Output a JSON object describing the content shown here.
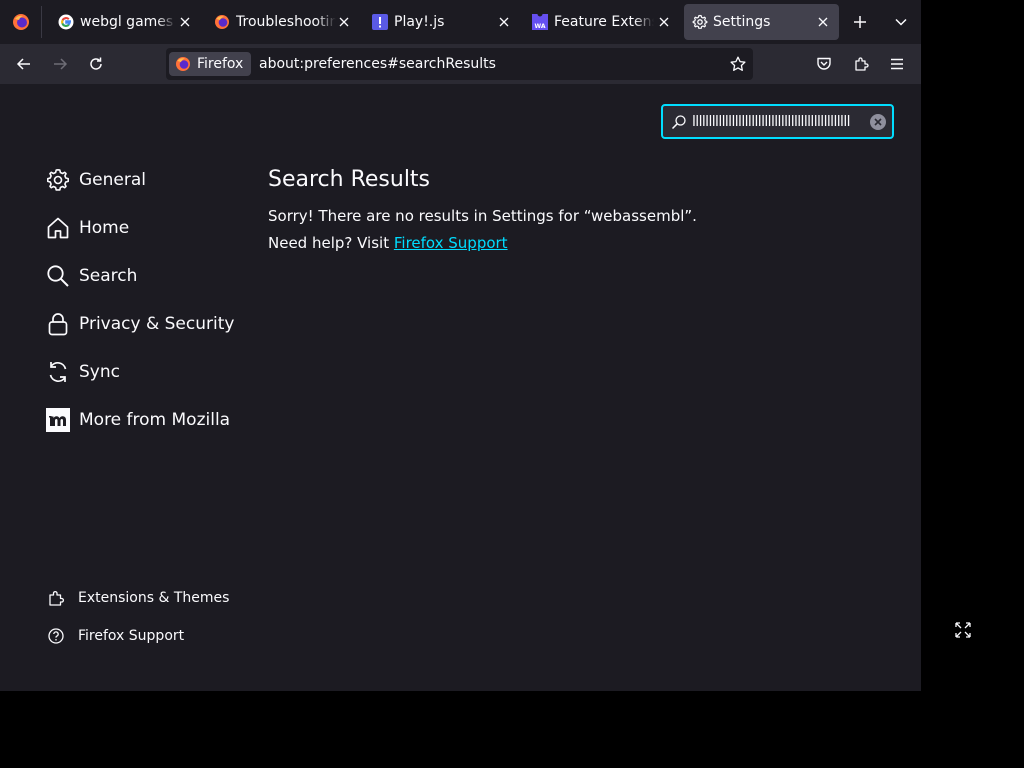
{
  "tabs": [
    {
      "title": "webgl games -",
      "favicon": "google-icon",
      "active": false
    },
    {
      "title": "Troubleshooting",
      "favicon": "firefox-icon",
      "active": false
    },
    {
      "title": "Play!.js",
      "favicon": "playjs-icon",
      "active": false
    },
    {
      "title": "Feature Extensions",
      "favicon": "webassembly-icon",
      "active": false
    },
    {
      "title": "Settings",
      "favicon": "gear-icon",
      "active": true
    }
  ],
  "toolbar": {
    "identity_label": "Firefox",
    "url": "about:preferences#searchResults"
  },
  "search": {
    "value": "llllllllllllllllllllllllllllllllllllllllllllllll"
  },
  "sidebar": {
    "items": [
      {
        "label": "General",
        "icon": "gear-icon"
      },
      {
        "label": "Home",
        "icon": "home-icon"
      },
      {
        "label": "Search",
        "icon": "search-icon"
      },
      {
        "label": "Privacy & Security",
        "icon": "lock-icon"
      },
      {
        "label": "Sync",
        "icon": "sync-icon"
      },
      {
        "label": "More from Mozilla",
        "icon": "mozilla-icon"
      }
    ],
    "footer": [
      {
        "label": "Extensions & Themes",
        "icon": "puzzle-icon"
      },
      {
        "label": "Firefox Support",
        "icon": "help-icon"
      }
    ]
  },
  "results": {
    "title": "Search Results",
    "message": "Sorry! There are no results in Settings for “webassembl”.",
    "help_prefix": "Need help? Visit ",
    "help_link": "Firefox Support"
  },
  "colors": {
    "accent": "#00ddff",
    "background": "#1c1b22",
    "toolbar": "#2b2a33",
    "active_tab": "#42414d"
  }
}
